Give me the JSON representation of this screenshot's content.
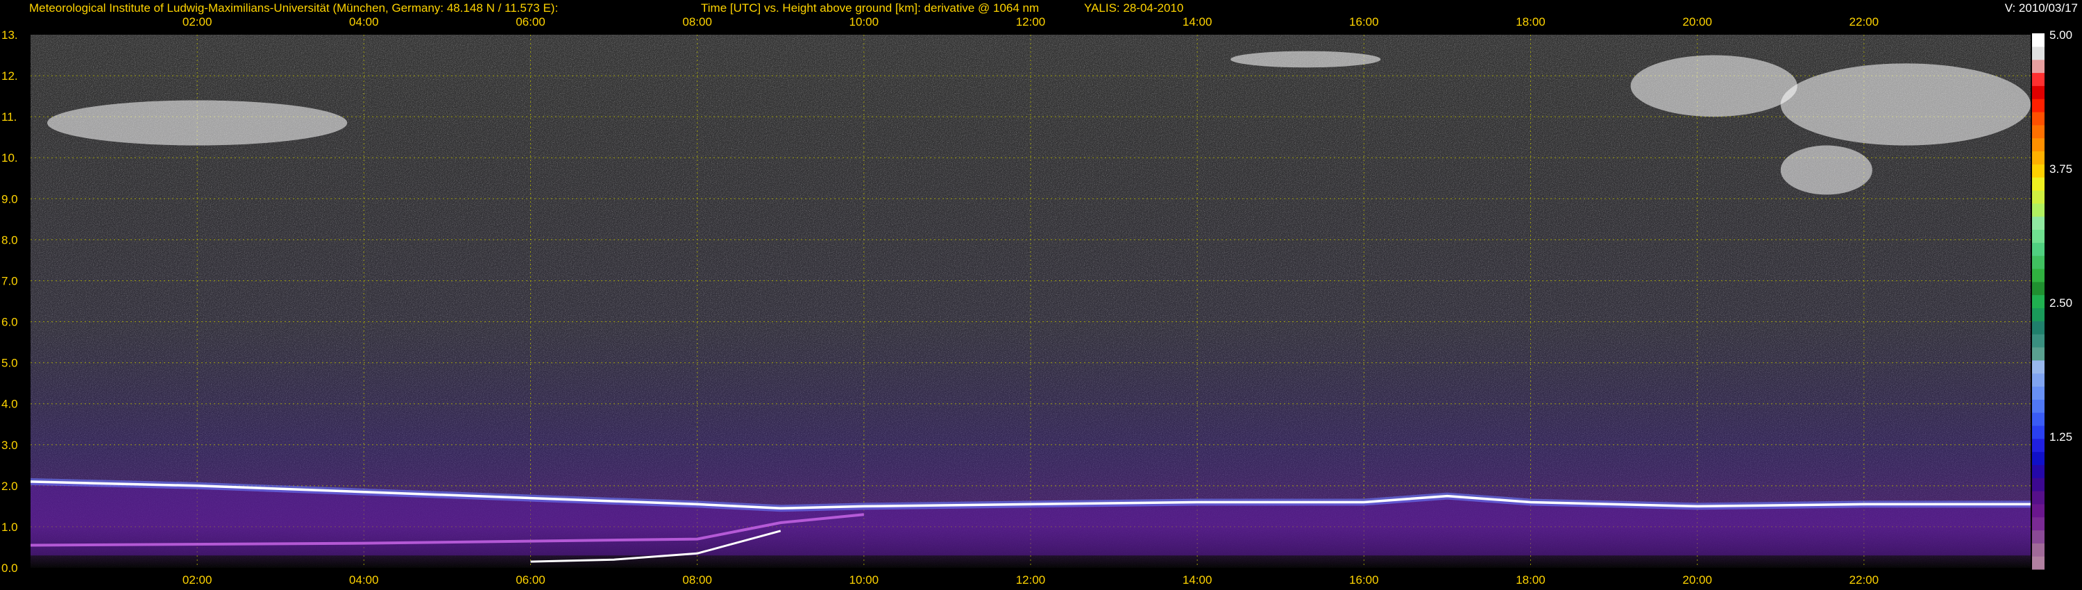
{
  "header": {
    "title": "Meteorological Institute of Ludwig-Maximilians-Universität (München, Germany: 48.148 N / 11.573 E):",
    "subtitle": "Time [UTC] vs. Height above ground [km]: derivative @ 1064 nm",
    "instrument": "YALIS: 28-04-2010",
    "version": "V: 2010/03/17"
  },
  "colors": {
    "axis_text": "#ffd400",
    "grid": "#b8b800",
    "background": "#000000"
  },
  "chart_data": {
    "type": "heatmap",
    "title": "Time [UTC] vs. Height above ground [km]: derivative @ 1064 nm",
    "xlabel": "Time [UTC]",
    "ylabel": "Height above ground [km]",
    "x_unit": "hour UTC",
    "xlim": [
      0,
      24
    ],
    "ylim": [
      0,
      13
    ],
    "x_ticks": [
      {
        "value": 2,
        "label": "02:00"
      },
      {
        "value": 4,
        "label": "04:00"
      },
      {
        "value": 6,
        "label": "06:00"
      },
      {
        "value": 8,
        "label": "08:00"
      },
      {
        "value": 10,
        "label": "10:00"
      },
      {
        "value": 12,
        "label": "12:00"
      },
      {
        "value": 14,
        "label": "14:00"
      },
      {
        "value": 16,
        "label": "16:00"
      },
      {
        "value": 18,
        "label": "18:00"
      },
      {
        "value": 20,
        "label": "20:00"
      },
      {
        "value": 22,
        "label": "22:00"
      }
    ],
    "y_ticks": [
      {
        "value": 0,
        "label": "0.0"
      },
      {
        "value": 1,
        "label": "1.0"
      },
      {
        "value": 2,
        "label": "2.0"
      },
      {
        "value": 3,
        "label": "3.0"
      },
      {
        "value": 4,
        "label": "4.0"
      },
      {
        "value": 5,
        "label": "5.0"
      },
      {
        "value": 6,
        "label": "6.0"
      },
      {
        "value": 7,
        "label": "7.0"
      },
      {
        "value": 8,
        "label": "8.0"
      },
      {
        "value": 9,
        "label": "9.0"
      },
      {
        "value": 10,
        "label": "10."
      },
      {
        "value": 11,
        "label": "11."
      },
      {
        "value": 12,
        "label": "12."
      },
      {
        "value": 13,
        "label": "13."
      }
    ],
    "grid": true,
    "boundary_layer_top_km": [
      {
        "x": 0,
        "y": 2.1
      },
      {
        "x": 2,
        "y": 2.0
      },
      {
        "x": 4,
        "y": 1.85
      },
      {
        "x": 6,
        "y": 1.7
      },
      {
        "x": 8,
        "y": 1.55
      },
      {
        "x": 9,
        "y": 1.45
      },
      {
        "x": 10,
        "y": 1.5
      },
      {
        "x": 12,
        "y": 1.55
      },
      {
        "x": 14,
        "y": 1.6
      },
      {
        "x": 16,
        "y": 1.6
      },
      {
        "x": 17,
        "y": 1.75
      },
      {
        "x": 18,
        "y": 1.6
      },
      {
        "x": 20,
        "y": 1.5
      },
      {
        "x": 22,
        "y": 1.55
      },
      {
        "x": 24,
        "y": 1.55
      }
    ],
    "residual_layer_top_km": [
      {
        "x": 0,
        "y": 0.55
      },
      {
        "x": 4,
        "y": 0.6
      },
      {
        "x": 6,
        "y": 0.65
      },
      {
        "x": 8,
        "y": 0.7
      },
      {
        "x": 9,
        "y": 1.1
      },
      {
        "x": 10,
        "y": 1.3
      }
    ],
    "surface_layer_top_km": [
      {
        "x": 6,
        "y": 0.15
      },
      {
        "x": 7,
        "y": 0.2
      },
      {
        "x": 8,
        "y": 0.35
      },
      {
        "x": 9,
        "y": 0.9
      }
    ],
    "cirrus_clouds": [
      {
        "x_start": 0.2,
        "x_end": 3.8,
        "y_low": 10.3,
        "y_high": 11.4
      },
      {
        "x_start": 14.4,
        "x_end": 16.2,
        "y_low": 12.2,
        "y_high": 12.6
      },
      {
        "x_start": 19.2,
        "x_end": 21.2,
        "y_low": 11.0,
        "y_high": 12.5
      },
      {
        "x_start": 21.0,
        "x_end": 24.0,
        "y_low": 10.3,
        "y_high": 12.3
      },
      {
        "x_start": 21.0,
        "x_end": 22.1,
        "y_low": 9.1,
        "y_high": 10.3
      }
    ],
    "colorbar": {
      "min": 0,
      "max": 5.0,
      "tick_labels": [
        "5.00",
        "3.75",
        "2.50",
        "1.25"
      ],
      "tick_values": [
        5.0,
        3.75,
        2.5,
        1.25
      ],
      "colors": [
        "#b080a0",
        "#a06a98",
        "#8a4a96",
        "#7a2a94",
        "#6a168e",
        "#56108a",
        "#3c0890",
        "#2408a8",
        "#1010c8",
        "#2020e0",
        "#2a40f0",
        "#3a5cf4",
        "#5078f4",
        "#6890f4",
        "#80a4f0",
        "#98b8ec",
        "#5aa090",
        "#3a9080",
        "#20806c",
        "#1a9a5a",
        "#20b050",
        "#209030",
        "#30b040",
        "#40c060",
        "#50d080",
        "#70e090",
        "#90e8a0",
        "#b0f060",
        "#d0f040",
        "#f0f020",
        "#ffd000",
        "#ffb000",
        "#ff9000",
        "#ff7000",
        "#ff5000",
        "#ff2000",
        "#e00000",
        "#ff3030",
        "#e8a0a0",
        "#e0e0e0",
        "#ffffff"
      ]
    }
  }
}
